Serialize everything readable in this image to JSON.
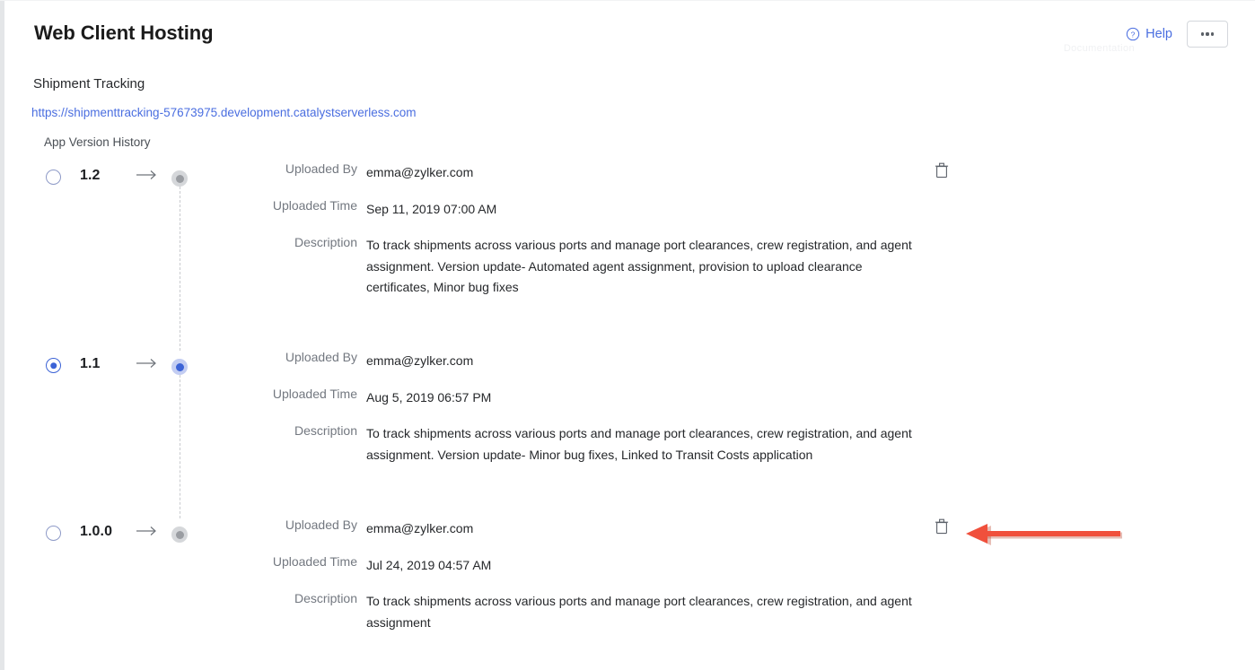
{
  "header": {
    "title": "Web Client Hosting",
    "help_label": "Help",
    "help_icon": "question-circle-icon",
    "more_icon": "ellipsis-icon",
    "ghost_text": "Documentation"
  },
  "app": {
    "name": "Shipment Tracking",
    "url": "https://shipmenttracking-57673975.development.catalystserverless.com",
    "section_label": "App Version History"
  },
  "labels": {
    "uploaded_by": "Uploaded By",
    "uploaded_time": "Uploaded Time",
    "description": "Description",
    "arrow_icon": "arrow-right-icon",
    "delete_icon": "trash-icon"
  },
  "versions": [
    {
      "number": "1.2",
      "selected": false,
      "uploaded_by": "emma@zylker.com",
      "uploaded_time": "Sep 11, 2019 07:00 AM",
      "description": "To track shipments across various ports and manage port clearances, crew registration, and agent assignment. Version update- Automated agent assignment, provision to upload clearance certificates, Minor bug fixes",
      "has_delete": true
    },
    {
      "number": "1.1",
      "selected": true,
      "uploaded_by": "emma@zylker.com",
      "uploaded_time": " Aug 5, 2019 06:57 PM",
      "description": "To track shipments across various ports and manage port clearances, crew registration, and agent assignment. Version update- Minor bug fixes, Linked to Transit Costs application",
      "has_delete": false
    },
    {
      "number": "1.0.0",
      "selected": false,
      "uploaded_by": "emma@zylker.com",
      "uploaded_time": "Jul 24, 2019 04:57 AM",
      "description": "To track shipments across various ports and manage port clearances, crew registration, and agent assignment",
      "has_delete": true
    }
  ],
  "annotation": {
    "type": "arrow-left",
    "color": "#f0503c",
    "points_to": "trash-icon-version-1.0.0"
  },
  "colors": {
    "accent": "#4a6ee0",
    "selected": "#3c63d6",
    "text": "#26282b",
    "muted": "#737880",
    "annotation": "#f0503c"
  }
}
